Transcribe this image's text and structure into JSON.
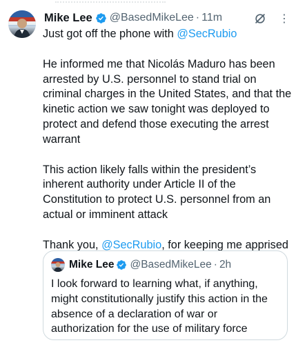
{
  "tweet": {
    "author": {
      "name": "Mike Lee",
      "handle": "@BasedMikeLee",
      "time": "11m"
    },
    "text": {
      "p1_prefix": "Just got off the phone with ",
      "p1_mention": "@SecRubio",
      "p2": "He informed me that Nicolás Maduro has been arrested by U.S. personnel to stand trial on criminal charges in the United States, and that the kinetic action we saw tonight was deployed to protect and defend those executing the arrest warrant",
      "p3": "This action likely falls within the president’s inherent authority under Article II of the Constitution to protect U.S. personnel from an actual or imminent attack",
      "p4_prefix": "Thank you, ",
      "p4_mention": "@SecRubio",
      "p4_suffix": ", for keeping me apprised"
    },
    "icons": {
      "verified": "verified-badge-icon",
      "grok": "grok-icon",
      "more": "more-icon"
    }
  },
  "quote": {
    "author": {
      "name": "Mike Lee",
      "handle": "@BasedMikeLee",
      "time": "2h"
    },
    "text": "I look forward to learning what, if anything, might constitutionally justify this action in the absence of a declaration of war or authorization for the use of military force"
  },
  "colors": {
    "link": "#1d9bf0",
    "secondary_text": "#536471",
    "border": "#cfd9de",
    "verified_badge": "#1d9bf0"
  }
}
